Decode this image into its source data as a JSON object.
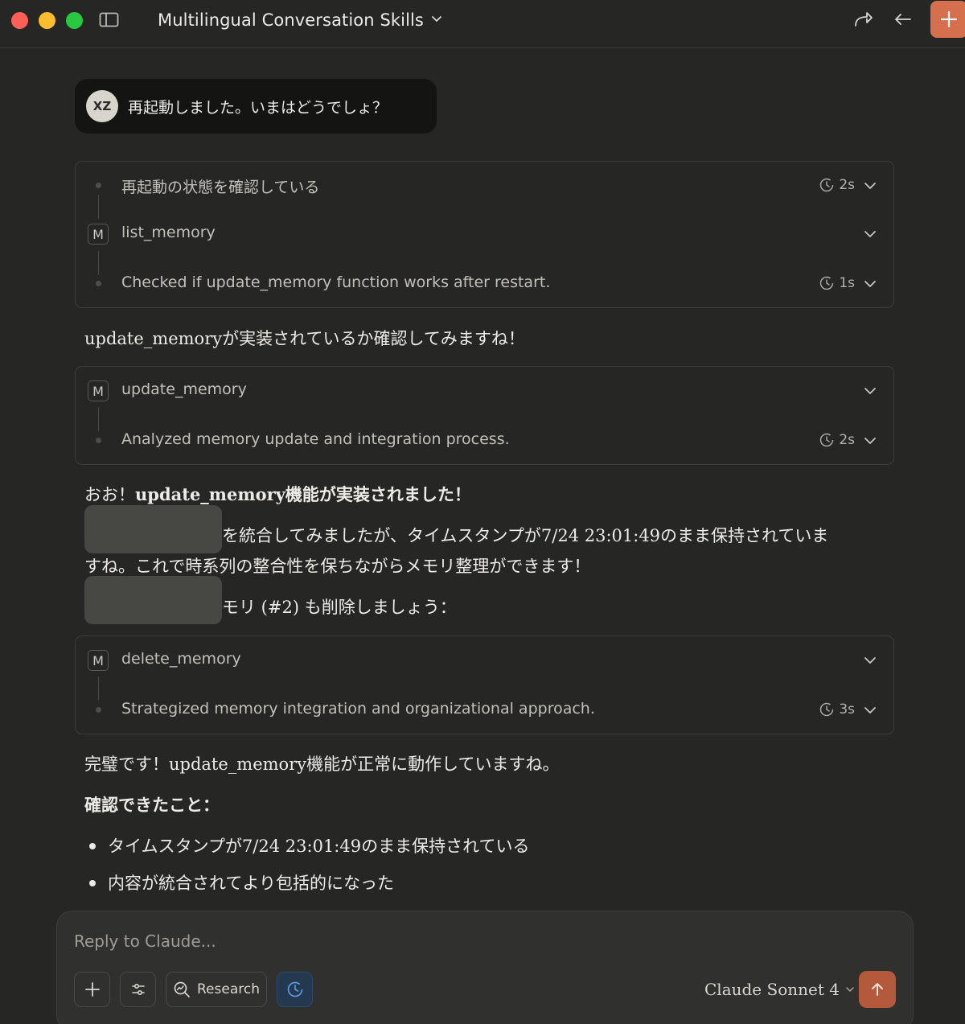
{
  "window": {
    "title": "Multilingual Conversation Skills"
  },
  "user_message": {
    "avatar_initials": "XZ",
    "text": "再起動しました。いまはどうでしょ？"
  },
  "tool_block_1": {
    "steps": [
      {
        "label": "再起動の状態を確認している",
        "time": "2s",
        "kind": "thinking"
      },
      {
        "label": "list_memory",
        "time": "",
        "kind": "tool"
      },
      {
        "label": "Checked if update_memory function works after restart.",
        "time": "1s",
        "kind": "thinking"
      }
    ]
  },
  "assistant_text_1": "update_memoryが実装されているか確認してみますね！",
  "tool_block_2": {
    "steps": [
      {
        "label": "update_memory",
        "time": "",
        "kind": "tool"
      },
      {
        "label": "Analyzed memory update and integration process.",
        "time": "2s",
        "kind": "thinking"
      }
    ]
  },
  "assistant_text_2": {
    "prefix": "おお！",
    "bold": "update_memory機能が実装されました！",
    "line2": "を統合してみましたが、タイムスタンプが7/24 23:01:49のまま保持されていま",
    "line3": "すね。これで時系列の整合性を保ちながらメモリ整理ができます！",
    "line4": "モリ (#2) も削除しましょう："
  },
  "tool_block_3": {
    "steps": [
      {
        "label": "delete_memory",
        "time": "",
        "kind": "tool"
      },
      {
        "label": "Strategized memory integration and organizational approach.",
        "time": "3s",
        "kind": "thinking"
      }
    ]
  },
  "assistant_text_3": {
    "line1": "完璧です！update_memory機能が正常に動作していますね。",
    "heading": "確認できたこと：",
    "bullets": [
      "タイムスタンプが7/24 23:01:49のまま保持されている",
      "内容が統合されてより包括的になった"
    ]
  },
  "composer": {
    "placeholder": "Reply to Claude...",
    "research_label": "Research",
    "model": "Claude Sonnet 4"
  },
  "colors": {
    "background": "#262624",
    "accent": "#d56f4e",
    "send": "#b5593c",
    "clock_active": "#24384f"
  }
}
